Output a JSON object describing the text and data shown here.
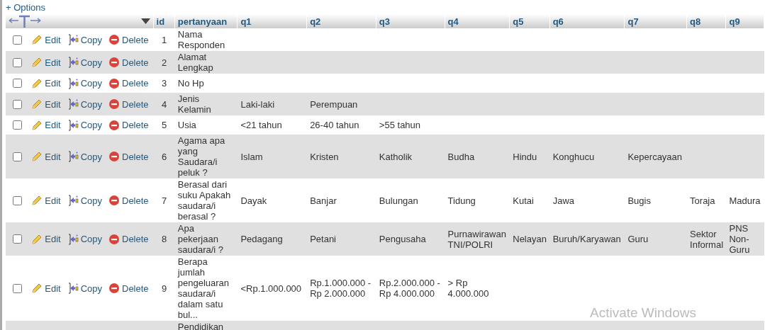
{
  "options_link": "+ Options",
  "table": {
    "columns": [
      "id",
      "pertanyaan",
      "q1",
      "q2",
      "q3",
      "q4",
      "q5",
      "q6",
      "q7",
      "q8",
      "q9"
    ],
    "rows": [
      {
        "kind": "full",
        "checked": false,
        "edit": "Edit",
        "copy": "Copy",
        "delete": "Delete",
        "id": "1",
        "pertanyaan": "Nama Responden",
        "answers": []
      },
      {
        "kind": "full",
        "checked": false,
        "edit": "Edit",
        "copy": "Copy",
        "delete": "Delete",
        "id": "2",
        "pertanyaan": "Alamat Lengkap",
        "answers": []
      },
      {
        "kind": "full",
        "checked": false,
        "edit": "Edit",
        "copy": "Copy",
        "delete": "Delete",
        "id": "3",
        "pertanyaan": "No Hp",
        "answers": []
      },
      {
        "kind": "full",
        "checked": false,
        "edit": "Edit",
        "copy": "Copy",
        "delete": "Delete",
        "id": "4",
        "pertanyaan": "Jenis Kelamin",
        "answers": [
          "Laki-laki",
          "Perempuan"
        ]
      },
      {
        "kind": "full",
        "checked": false,
        "edit": "Edit",
        "copy": "Copy",
        "delete": "Delete",
        "id": "5",
        "pertanyaan": "Usia",
        "answers": [
          "<21 tahun",
          "26-40 tahun",
          ">55 tahun"
        ]
      },
      {
        "kind": "full",
        "checked": false,
        "edit": "Edit",
        "copy": "Copy",
        "delete": "Delete",
        "id": "6",
        "pertanyaan": "Agama apa yang Saudara/i peluk ?",
        "answers": [
          "Islam",
          "Kristen",
          "Katholik",
          "Budha",
          "Hindu",
          "Konghucu",
          "Kepercayaan"
        ]
      },
      {
        "kind": "full",
        "checked": false,
        "edit": "Edit",
        "copy": "Copy",
        "delete": "Delete",
        "id": "7",
        "pertanyaan": "Berasal dari suku Apakah saudara/i berasal ?",
        "answers": [
          "Dayak",
          "Banjar",
          "Bulungan",
          "Tidung",
          "Kutai",
          "Jawa",
          "Bugis",
          "Toraja",
          "Madura"
        ]
      },
      {
        "kind": "full",
        "checked": false,
        "edit": "Edit",
        "copy": "Copy",
        "delete": "Delete",
        "id": "8",
        "pertanyaan": "Apa pekerjaan saudara/i ?",
        "answers": [
          "Pedagang",
          "Petani",
          "Pengusaha",
          "Purnawirawan TNI/POLRI",
          "Nelayan",
          "Buruh/Karyawan",
          "Guru",
          "Sektor Informal",
          "PNS Non-Guru"
        ]
      },
      {
        "kind": "full",
        "checked": false,
        "edit": "Edit",
        "copy": "Copy",
        "delete": "Delete",
        "id": "9",
        "pertanyaan": "Berapa jumlah pengeluaran saudara/i dalam satu bul...",
        "answers": [
          "<Rp.1.000.000",
          "Rp.1.000.000 - Rp 2.000.000",
          "Rp.2.000.000 - Rp 4.000.000",
          "> Rp 4.000.000"
        ]
      },
      {
        "kind": "cut",
        "pertanyaan": "Pendidikan"
      }
    ]
  },
  "os_overlay": {
    "title": "Activate Windows"
  }
}
